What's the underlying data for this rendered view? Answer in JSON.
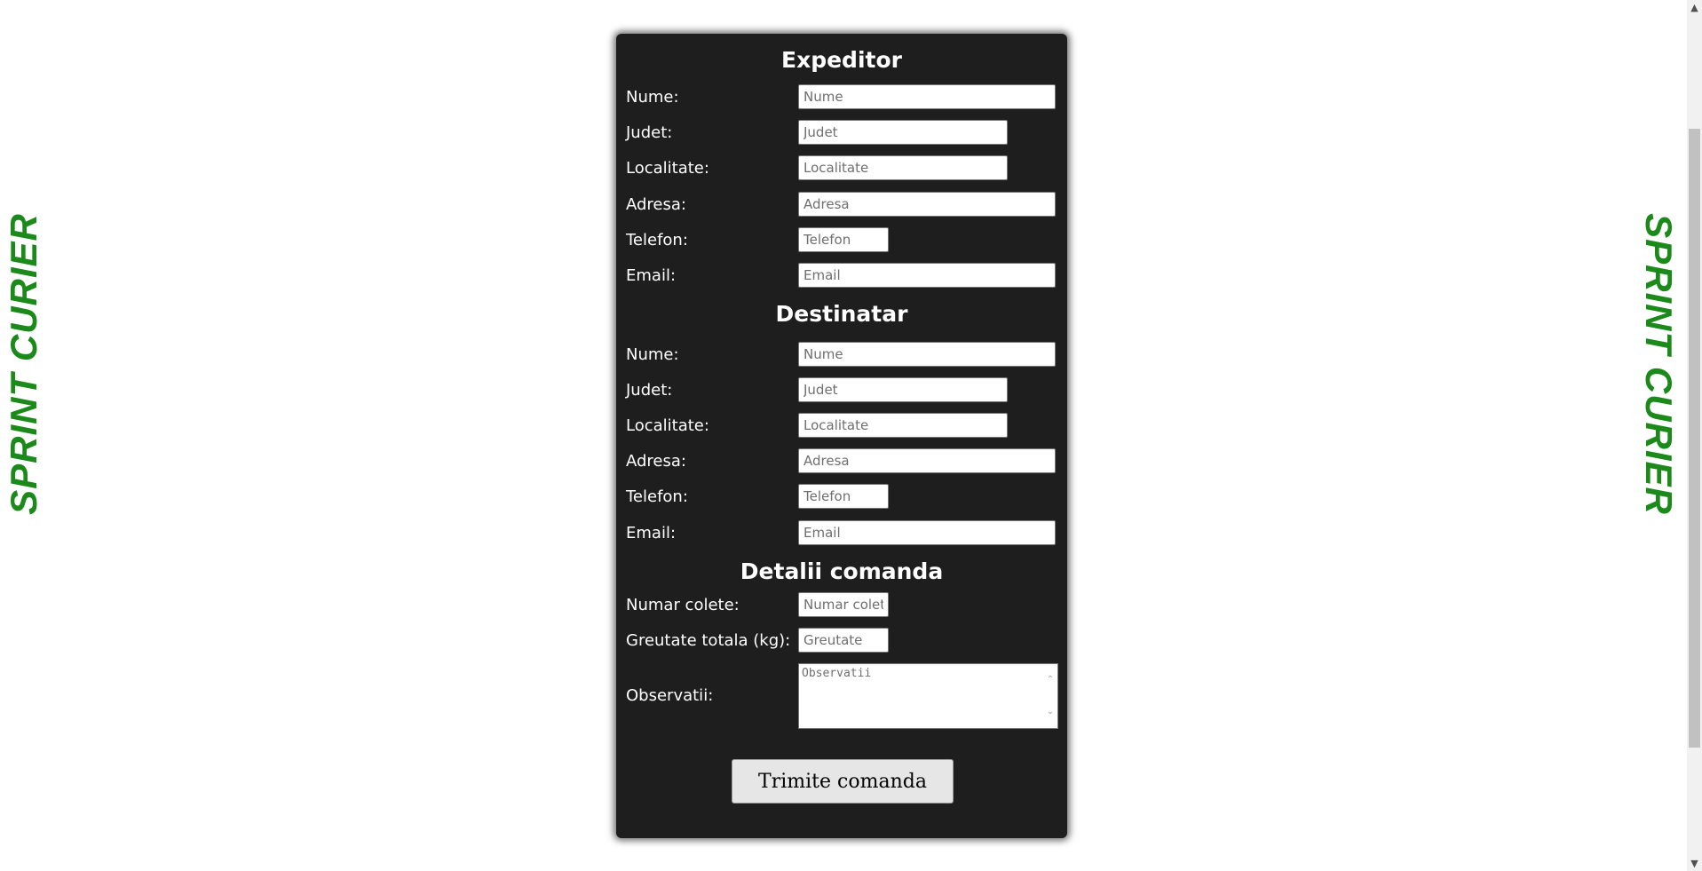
{
  "brand": {
    "left_text": "SPRINT CURIER",
    "right_text": "SPRINT CURIER",
    "color": "#1b8a1b"
  },
  "expeditor": {
    "title": "Expeditor",
    "nume": {
      "label": "Nume:",
      "placeholder": "Nume"
    },
    "judet": {
      "label": "Judet:",
      "placeholder": "Judet"
    },
    "localitate": {
      "label": "Localitate:",
      "placeholder": "Localitate"
    },
    "adresa": {
      "label": "Adresa:",
      "placeholder": "Adresa"
    },
    "telefon": {
      "label": "Telefon:",
      "placeholder": "Telefon"
    },
    "email": {
      "label": "Email:",
      "placeholder": "Email"
    }
  },
  "destinatar": {
    "title": "Destinatar",
    "nume": {
      "label": "Nume:",
      "placeholder": "Nume"
    },
    "judet": {
      "label": "Judet:",
      "placeholder": "Judet"
    },
    "localitate": {
      "label": "Localitate:",
      "placeholder": "Localitate"
    },
    "adresa": {
      "label": "Adresa:",
      "placeholder": "Adresa"
    },
    "telefon": {
      "label": "Telefon:",
      "placeholder": "Telefon"
    },
    "email": {
      "label": "Email:",
      "placeholder": "Email"
    }
  },
  "comanda": {
    "title": "Detalii comanda",
    "colete": {
      "label": "Numar colete:",
      "placeholder": "Numar colete"
    },
    "greutate": {
      "label": "Greutate totala (kg):",
      "placeholder": "Greutate"
    },
    "observatii": {
      "label": "Observatii:",
      "placeholder": "Observatii"
    },
    "submit_label": "Trimite comanda"
  },
  "colors": {
    "card_background": "#1e1e1e",
    "page_background": "#ffffff"
  }
}
